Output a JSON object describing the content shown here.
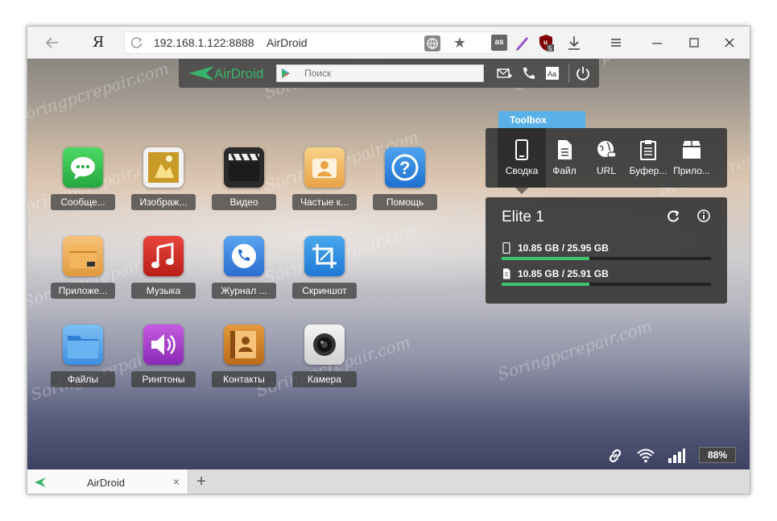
{
  "browser": {
    "url": "192.168.1.122:8888",
    "page_title": "AirDroid",
    "ext_lastfm": "as",
    "ext_ublock_badge": "5",
    "ya_label": "Я"
  },
  "airdroid": {
    "logo_text": "AirDroid",
    "search_placeholder": "Поиск"
  },
  "apps": [
    {
      "label": "Сообще...",
      "icon": "messages-icon"
    },
    {
      "label": "Изображ...",
      "icon": "photos-icon"
    },
    {
      "label": "Видео",
      "icon": "video-icon"
    },
    {
      "label": "Частые к...",
      "icon": "frequent-contacts-icon"
    },
    {
      "label": "Помощь",
      "icon": "help-icon"
    },
    {
      "label": "Приложе...",
      "icon": "apps-icon"
    },
    {
      "label": "Музыка",
      "icon": "music-icon"
    },
    {
      "label": "Журнал ...",
      "icon": "call-log-icon"
    },
    {
      "label": "Скриншот",
      "icon": "screenshot-icon"
    },
    {
      "label": "Файлы",
      "icon": "files-icon"
    },
    {
      "label": "Рингтоны",
      "icon": "ringtones-icon"
    },
    {
      "label": "Контакты",
      "icon": "contacts-icon"
    },
    {
      "label": "Камера",
      "icon": "camera-icon"
    }
  ],
  "toolbox": {
    "tab_label": "Toolbox",
    "tools": [
      {
        "label": "Сводка",
        "icon": "phone-icon"
      },
      {
        "label": "Файл",
        "icon": "file-icon"
      },
      {
        "label": "URL",
        "icon": "globe-link-icon"
      },
      {
        "label": "Буфер...",
        "icon": "clipboard-icon"
      },
      {
        "label": "Прило...",
        "icon": "app-box-icon"
      }
    ]
  },
  "device": {
    "name": "Elite 1",
    "storage": [
      {
        "text": "10.85 GB / 25.95 GB",
        "fraction": 0.418,
        "icon": "phone-storage-icon"
      },
      {
        "text": "10.85 GB / 25.91 GB",
        "fraction": 0.419,
        "icon": "sdcard-icon"
      }
    ]
  },
  "status": {
    "battery": "88%"
  },
  "watermark": "Soringpcrepair.com",
  "tab": {
    "title": "AirDroid",
    "close": "×",
    "new_tab": "+"
  },
  "colors": {
    "accent_green": "#3bb26b",
    "toolbox_blue": "#5ab0e8"
  }
}
